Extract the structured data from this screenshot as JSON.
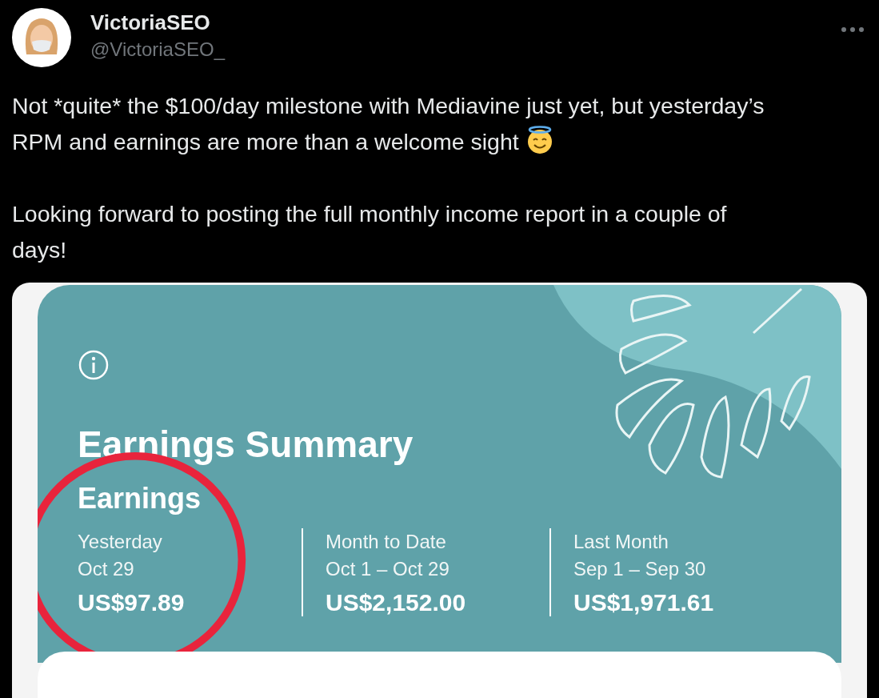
{
  "author": {
    "name": "VictoriaSEO",
    "handle": "@VictoriaSEO_"
  },
  "tweet": {
    "paragraphs": [
      {
        "text": "Not *quite* the $100/day milestone with Mediavine just yet, but yesterday’s RPM and earnings are more than a welcome sight",
        "emoji": true
      },
      {
        "text": "Looking forward to posting the full monthly income report in a couple of days!",
        "emoji": false
      }
    ]
  },
  "media": {
    "title": "Earnings Summary",
    "section": "Earnings",
    "columns": [
      {
        "label": "Yesterday",
        "range": "Oct 29",
        "value": "US$97.89",
        "circled": true
      },
      {
        "label": "Month to Date",
        "range": "Oct 1 – Oct 29",
        "value": "US$2,152.00",
        "circled": false
      },
      {
        "label": "Last Month",
        "range": "Sep 1 – Sep 30",
        "value": "US$1,971.61",
        "circled": false
      }
    ]
  }
}
